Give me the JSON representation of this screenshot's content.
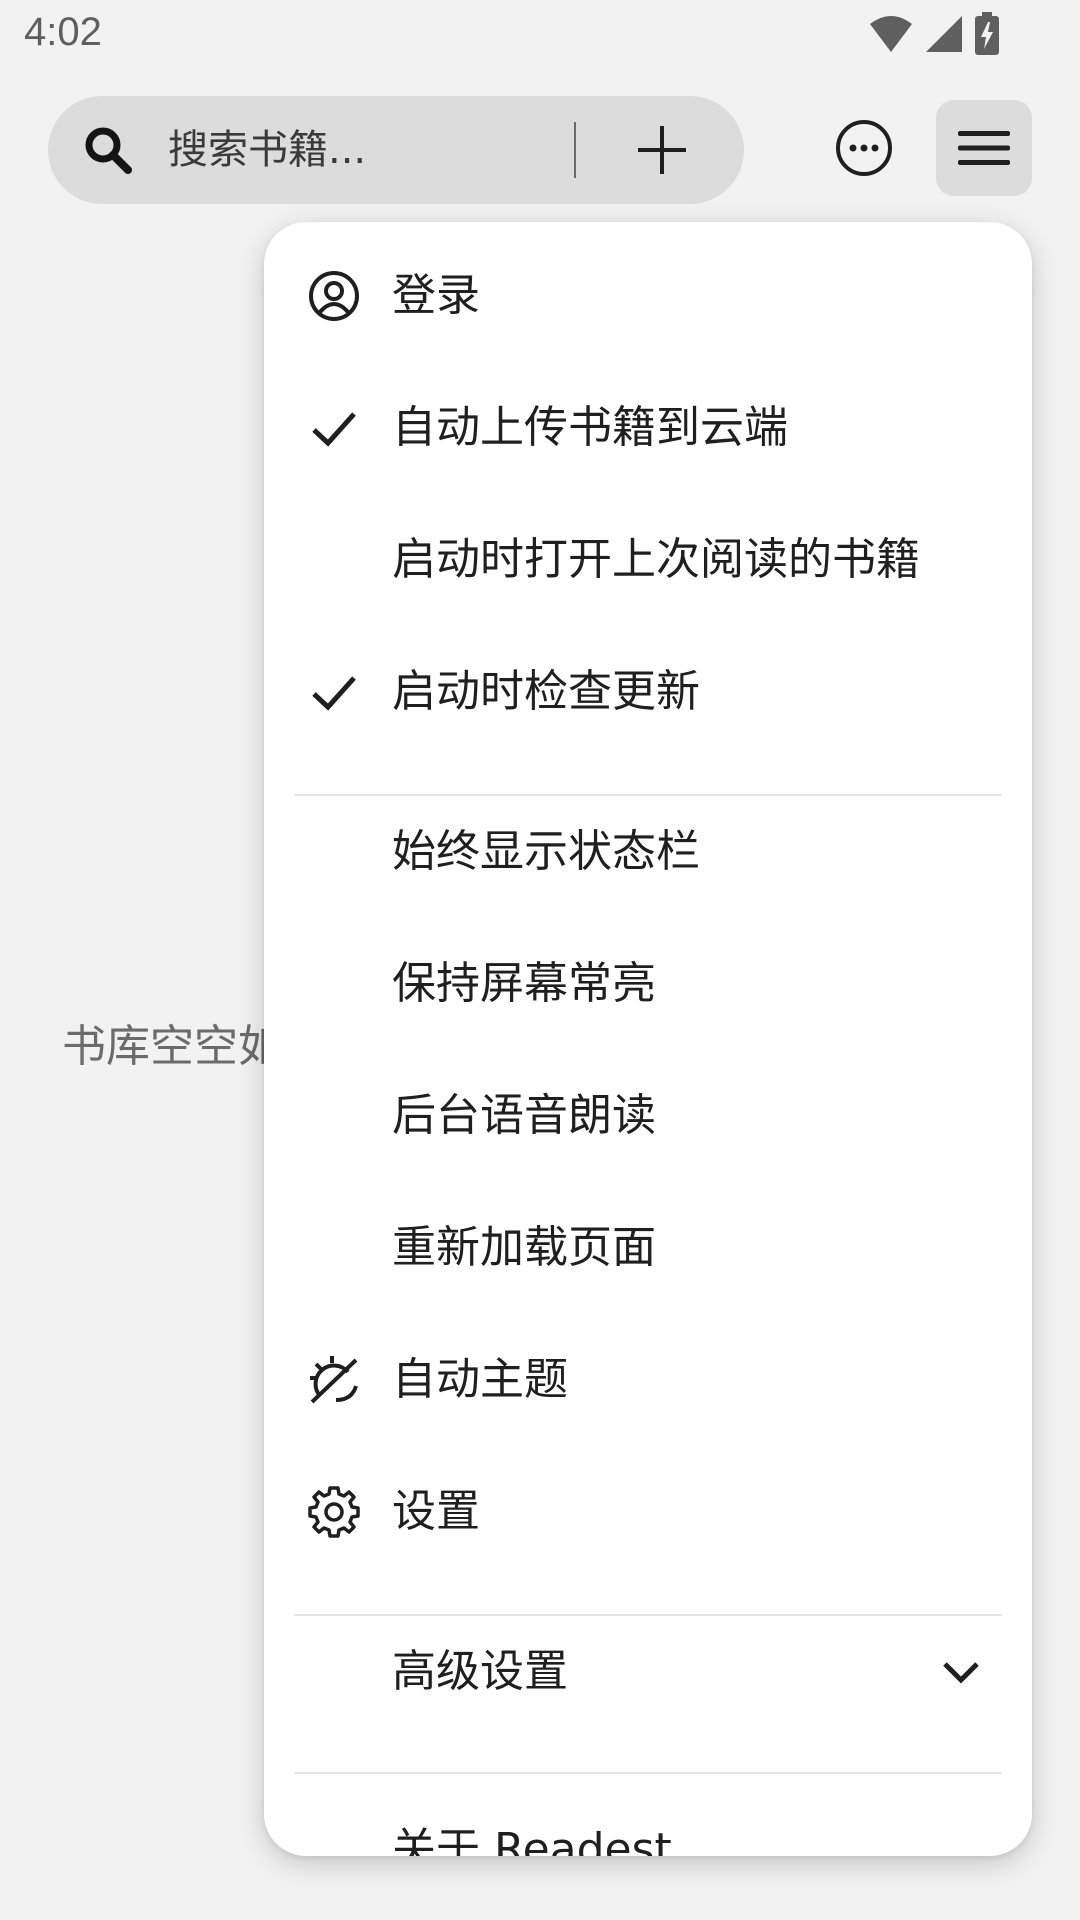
{
  "status_bar": {
    "time": "4:02"
  },
  "toolbar": {
    "search_placeholder": "搜索书籍...",
    "add_icon": "plus-icon",
    "more_icon": "more-circle-icon",
    "menu_icon": "hamburger-icon"
  },
  "library": {
    "empty_text": "书库空空如也"
  },
  "menu": {
    "items": [
      {
        "label": "登录",
        "icon": "account-circle-icon"
      },
      {
        "label": "自动上传书籍到云端",
        "icon": "check-icon",
        "checked": true
      },
      {
        "label": "启动时打开上次阅读的书籍",
        "checked": false
      },
      {
        "label": "启动时检查更新",
        "icon": "check-icon",
        "checked": true
      },
      {
        "label": "始终显示状态栏",
        "checked": false
      },
      {
        "label": "保持屏幕常亮",
        "checked": false
      },
      {
        "label": "后台语音朗读",
        "checked": false
      },
      {
        "label": "重新加载页面"
      },
      {
        "label": "自动主题",
        "icon": "auto-theme-icon"
      },
      {
        "label": "设置",
        "icon": "gear-icon"
      },
      {
        "label": "高级设置",
        "icon": "chevron-down-icon"
      },
      {
        "label": "关于 Readest"
      }
    ]
  },
  "colors": {
    "background": "#f2f2f2",
    "pill": "#dcdcdc",
    "menu_bg": "#ffffff",
    "text": "#1f1f1f",
    "muted_text": "#6b6b6b"
  }
}
